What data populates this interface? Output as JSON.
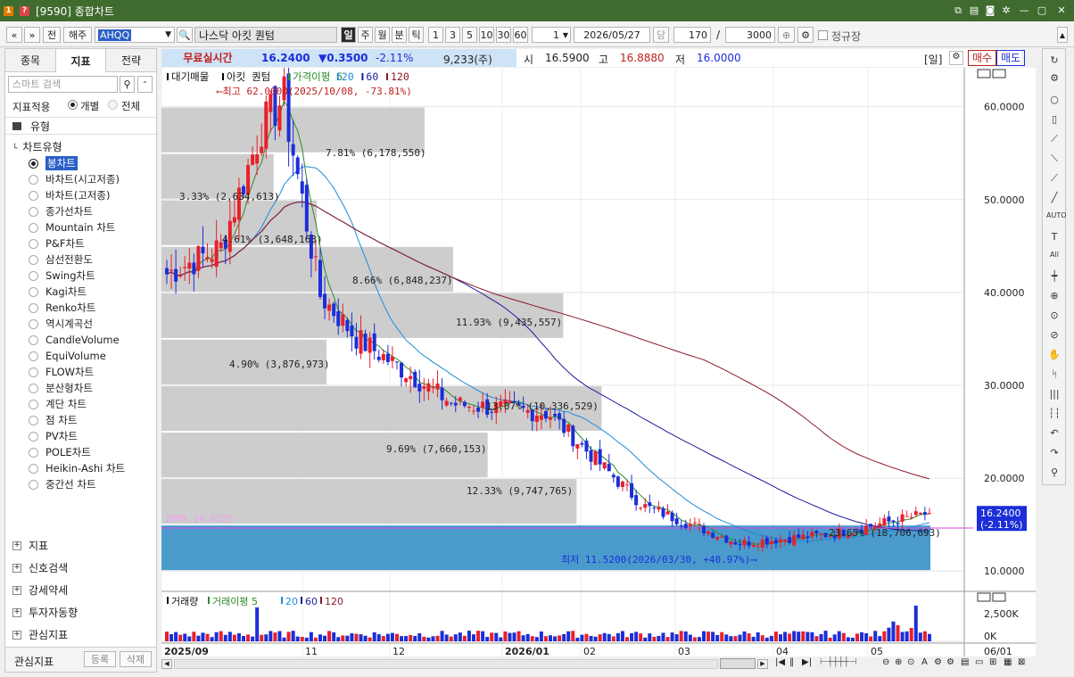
{
  "window": {
    "title": "[9590] 종합차트",
    "icon_a": "1",
    "icon_b": "?"
  },
  "toolbar": {
    "nav_prev": "«",
    "nav_down": "»",
    "btn_jeon": "전",
    "btn_haeju": "해주",
    "symbol": "AHQQ",
    "search_icon": "🔍",
    "name": "나스닥  아킷 퀀텀",
    "periods": [
      "일",
      "주",
      "월",
      "분",
      "틱"
    ],
    "intervals": [
      "1",
      "3",
      "5",
      "10",
      "30",
      "60"
    ],
    "count_select": "1",
    "date": "2026/05/27",
    "btn_dang": "당",
    "bars": "170",
    "slash": "/",
    "total": "3000",
    "regular_session_label": "정규장"
  },
  "sidebar": {
    "tabs": [
      "종목",
      "지표",
      "전략"
    ],
    "search_placeholder": "스마트 검색",
    "apply_label": "지표적용",
    "apply_each": "개별",
    "apply_all": "전체",
    "group_label": "유형",
    "tree_label": "차트유형",
    "chart_types": [
      "봉차트",
      "바차트(시고저종)",
      "바차트(고저종)",
      "종가선차트",
      "Mountain 차트",
      "P&F차트",
      "삼선전환도",
      "Swing차트",
      "Kagi차트",
      "Renko차트",
      "역시계곡선",
      "CandleVolume",
      "EquiVolume",
      "FLOW차트",
      "분산형차트",
      "계단 차트",
      "점 차트",
      "PV차트",
      "POLE차트",
      "Heikin-Ashi 차트",
      "중간선 차트"
    ],
    "selected_type": "봉차트",
    "sections": [
      "지표",
      "신호검색",
      "강세약세",
      "투자자동향",
      "관심지표"
    ],
    "bottom_label": "관심지표",
    "btn_register": "등록",
    "btn_delete": "삭제"
  },
  "infobar": {
    "realtime": "무료실시간",
    "price": "16.2400",
    "change": "▼0.3500",
    "change_pct": "-2.11%",
    "volume": "9,233(주)",
    "open_label": "시",
    "open": "16.5900",
    "high_label": "고",
    "high": "16.8880",
    "low_label": "저",
    "low": "16.0000",
    "period_tag": "[일]",
    "buy": "매수",
    "sell": "매도"
  },
  "chart": {
    "legend": [
      "대기매물",
      "아킷 퀀텀",
      "가격이평 5",
      "20",
      "60",
      "120"
    ],
    "legend_colors": [
      "#000000",
      "#000000",
      "#2c8c2c",
      "#1e8bd8",
      "#1c1c9e",
      "#8b1a2a"
    ],
    "high_note": "⟵최고 62.0000(2025/10/08, -73.81%)",
    "low_note": "최저 11.5200(2026/03/30, +40.97%)⟶",
    "ma20_label": "20MA 14.6225",
    "price_tag": "16.2400",
    "price_tag2": "(-2.11%)",
    "y_ticks": [
      "60.0000",
      "50.0000",
      "40.0000",
      "30.0000",
      "20.0000",
      "10.0000"
    ],
    "y_values": [
      60,
      50,
      40,
      30,
      20,
      10
    ],
    "x_labels": [
      "2025/09",
      "11",
      "12",
      "2026/01",
      "02",
      "03",
      "04",
      "05"
    ],
    "x_end_label": "06/01",
    "volume_profile": [
      {
        "pct": "7.81% (6,178,550)",
        "lo": 55,
        "hi": 60
      },
      {
        "pct": "3.33% (2,634,613)",
        "lo": 50,
        "hi": 55
      },
      {
        "pct": "4.61% (3,648,163)",
        "lo": 45,
        "hi": 50
      },
      {
        "pct": "8.66% (6,848,237)",
        "lo": 40,
        "hi": 45
      },
      {
        "pct": "11.93% (9,435,557)",
        "lo": 35,
        "hi": 40
      },
      {
        "pct": "4.90% (3,876,973)",
        "lo": 30,
        "hi": 35
      },
      {
        "pct": "13.07% (10,336,529)",
        "lo": 25,
        "hi": 30
      },
      {
        "pct": "9.69% (7,660,153)",
        "lo": 20,
        "hi": 25
      },
      {
        "pct": "12.33% (9,747,765)",
        "lo": 15,
        "hi": 20
      },
      {
        "pct": "23.65% (18,706,693)",
        "lo": 10,
        "hi": 15
      }
    ],
    "volume_legend": [
      "거래량",
      "거래이평 5",
      "20",
      "60",
      "120"
    ],
    "vol_ticks": [
      "2,500K",
      "0K"
    ],
    "colors": {
      "up": "#e8202a",
      "down": "#1b2ed8",
      "profile": "#c8c8c8",
      "profile_hot": "#4a9bcc"
    }
  },
  "chart_data": {
    "type": "candlestick",
    "series_label": "아킷 퀀텀",
    "y_range": [
      8,
      64
    ],
    "price_path": [
      {
        "month": "2025/09",
        "close": 42
      },
      {
        "month": "2025/10",
        "close": 47
      },
      {
        "month": "2025/11",
        "close": 35
      },
      {
        "month": "2025/12",
        "close": 28
      },
      {
        "month": "2026/01",
        "close": 27
      },
      {
        "month": "2026/02",
        "close": 17
      },
      {
        "month": "2026/03",
        "close": 13
      },
      {
        "month": "2026/04",
        "close": 14
      },
      {
        "month": "2026/05",
        "close": 16.24
      }
    ],
    "high": {
      "value": 62.0,
      "date": "2025/10/08"
    },
    "low": {
      "value": 11.52,
      "date": "2026/03/30"
    },
    "last": 16.24,
    "ma20": 14.6225
  }
}
